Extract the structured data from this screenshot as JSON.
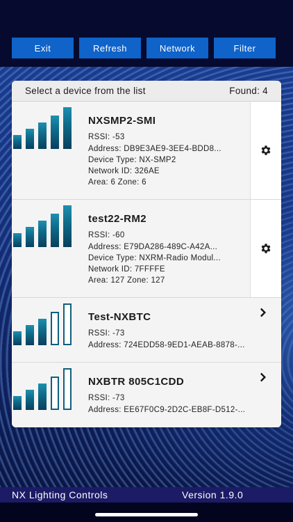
{
  "toolbar": {
    "exit_label": "Exit",
    "refresh_label": "Refresh",
    "network_label": "Network",
    "filter_label": "Filter"
  },
  "list": {
    "header_prompt": "Select a device from the list",
    "found_label": "Found: 4",
    "devices": [
      {
        "name": "NXSMP2-SMI",
        "rssi": "RSSI: -53",
        "address": "Address: DB9E3AE9-3EE4-BDD8...",
        "device_type": "Device Type: NX-SMP2",
        "network_id": "Network ID: 326AE",
        "area_zone": "Area: 6 Zone: 6",
        "signal_bars_filled": 5,
        "action_icon": "gear-icon"
      },
      {
        "name": "test22-RM2",
        "rssi": "RSSI: -60",
        "address": "Address: E79DA286-489C-A42A...",
        "device_type": "Device Type: NXRM-Radio Modul...",
        "network_id": "Network ID: 7FFFFE",
        "area_zone": "Area: 127 Zone: 127",
        "signal_bars_filled": 5,
        "action_icon": "gear-icon"
      },
      {
        "name": "Test-NXBTC",
        "rssi": "RSSI: -73",
        "address": "Address: 724EDD58-9ED1-AEAB-8878-...",
        "signal_bars_filled": 3,
        "action_icon": "chevron-right-icon"
      },
      {
        "name": "NXBTR 805C1CDD",
        "rssi": "RSSI: -73",
        "address": "Address: EE67F0C9-2D2C-EB8F-D512-...",
        "signal_bars_filled": 3,
        "action_icon": "chevron-right-icon"
      }
    ]
  },
  "footer": {
    "brand": "NX Lighting Controls",
    "version": "Version 1.9.0"
  },
  "colors": {
    "button_blue": "#0f63c9",
    "bar_teal": "#0f6c8c",
    "footer_purple": "#1c1b66"
  }
}
